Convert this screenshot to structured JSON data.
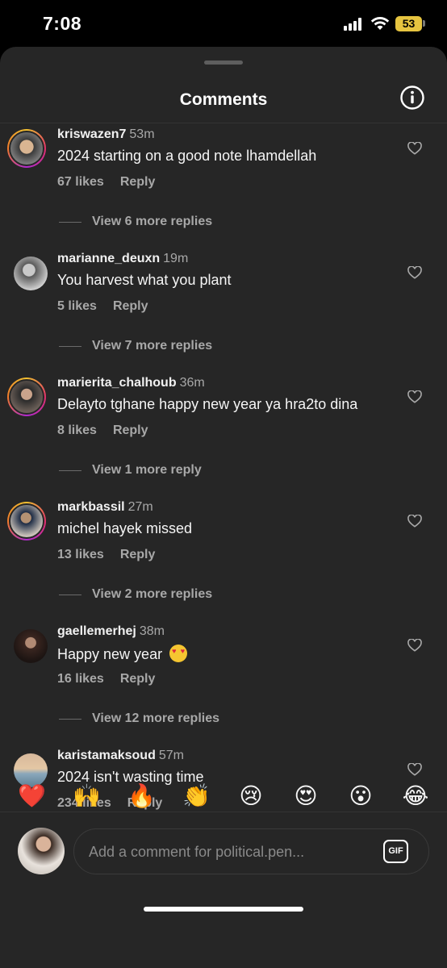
{
  "status_bar": {
    "time": "7:08",
    "battery": "53"
  },
  "sheet": {
    "title": "Comments"
  },
  "comments": [
    {
      "username": "kriswazen7",
      "time": "53m",
      "text": "2024 starting on a good note lhamdellah",
      "likes": "67 likes",
      "reply": "Reply",
      "view_more": "View 6 more replies"
    },
    {
      "username": "marianne_deuxn",
      "time": "19m",
      "text": "You harvest what you plant",
      "likes": "5 likes",
      "reply": "Reply",
      "view_more": "View 7 more replies"
    },
    {
      "username": "marierita_chalhoub",
      "time": "36m",
      "text": "Delayto tghane happy new year ya hra2to dina",
      "likes": "8 likes",
      "reply": "Reply",
      "view_more": "View 1 more reply"
    },
    {
      "username": "markbassil",
      "time": "27m",
      "text": "michel hayek missed",
      "likes": "13 likes",
      "reply": "Reply",
      "view_more": "View 2 more replies"
    },
    {
      "username": "gaellemerhej",
      "time": "38m",
      "text": "Happy new year",
      "emoji": "😍",
      "likes": "16 likes",
      "reply": "Reply",
      "view_more": "View 12 more replies"
    },
    {
      "username": "karistamaksoud",
      "time": "57m",
      "text": "2024 isn't wasting time",
      "likes": "234 likes",
      "reply": "Reply"
    }
  ],
  "reactions": [
    "❤️",
    "🙌",
    "🔥",
    "👏",
    "😢",
    "😍",
    "😮",
    "😂"
  ],
  "composer": {
    "placeholder": "Add a comment for political.pen...",
    "gif_label": "GIF"
  }
}
